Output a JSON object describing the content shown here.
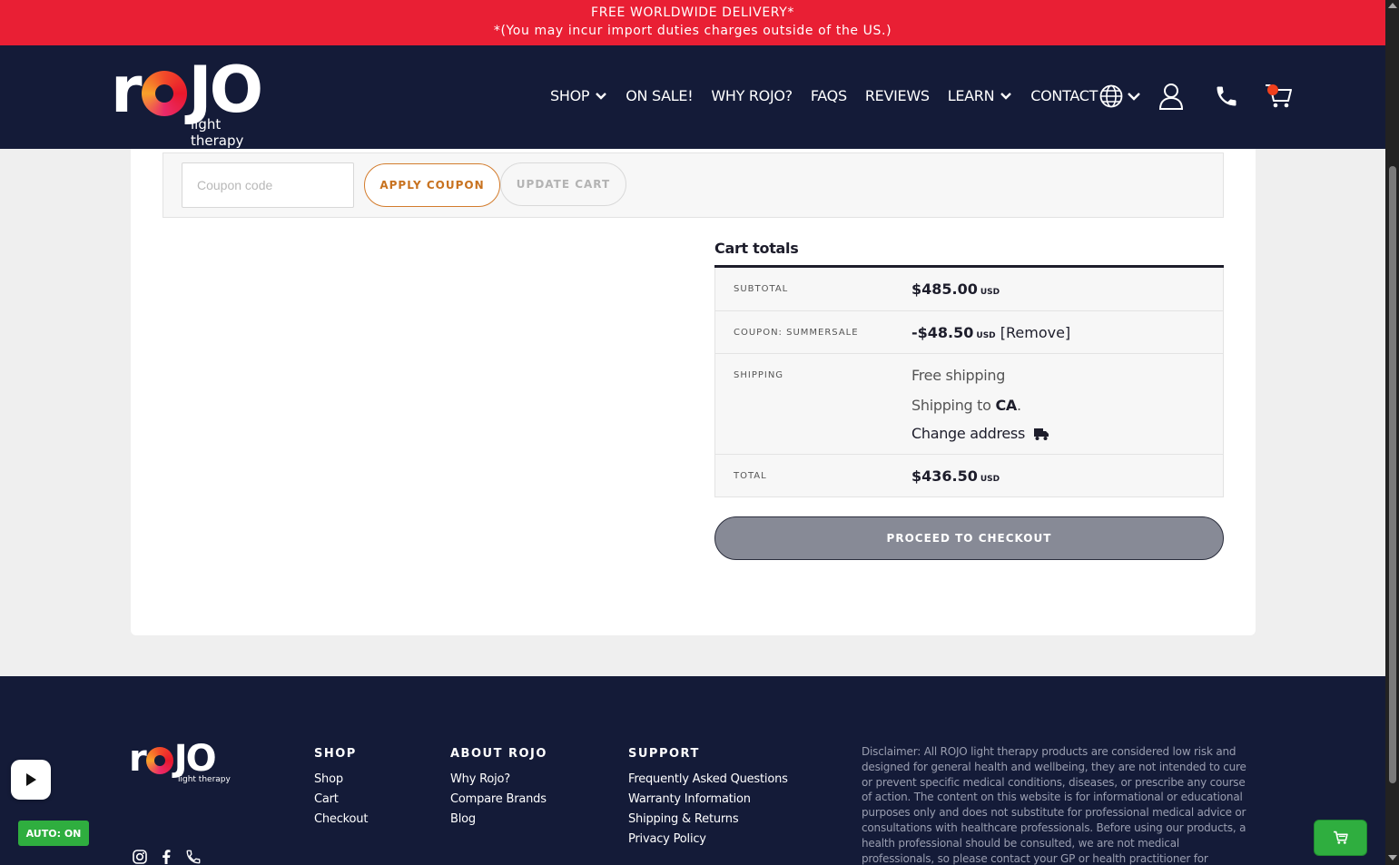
{
  "banner": {
    "line1": "FREE WORLDWIDE DELIVERY*",
    "line2": "*(You may incur import duties charges outside of the US.)"
  },
  "brand": {
    "word_r": "r",
    "word_jo": "JO",
    "tagline": "light therapy"
  },
  "nav": {
    "items": [
      "SHOP",
      "ON SALE!",
      "WHY ROJO?",
      "FAQS",
      "REVIEWS",
      "LEARN",
      "CONTACT"
    ]
  },
  "coupon": {
    "placeholder": "Coupon code",
    "apply_label": "APPLY COUPON",
    "update_label": "UPDATE CART"
  },
  "totals": {
    "title": "Cart totals",
    "subtotal_label": "SUBTOTAL",
    "subtotal_value": "$485.00",
    "coupon_label": "COUPON: SUMMERSALE",
    "coupon_value": "-$48.50",
    "remove_label": "[Remove]",
    "shipping_label": "SHIPPING",
    "shipping_method": "Free shipping",
    "shipping_to_prefix": "Shipping to ",
    "shipping_to_region": "CA",
    "shipping_to_suffix": ".",
    "change_address": "Change address",
    "total_label": "TOTAL",
    "total_value": "$436.50",
    "currency": "USD",
    "checkout_label": "PROCEED TO CHECKOUT"
  },
  "footer": {
    "shop": {
      "title": "SHOP",
      "links": [
        "Shop",
        "Cart",
        "Checkout"
      ]
    },
    "about": {
      "title": "ABOUT ROJO",
      "links": [
        "Why Rojo?",
        "Compare Brands",
        "Blog"
      ]
    },
    "support": {
      "title": "SUPPORT",
      "links": [
        "Frequently Asked Questions",
        "Warranty Information",
        "Shipping & Returns",
        "Privacy Policy"
      ]
    },
    "disclaimer": "Disclaimer: All ROJO light therapy products are considered low risk and designed for general health and wellbeing, they are not intended to cure or prevent specific medical conditions, diseases, or prescribe any course of action. The content on this website is for informational or educational purposes only and does not substitute for professional medical advice or consultations with healthcare professionals. Before using our products, a health professional should be consulted, we are not medical professionals, so please contact your GP or health practitioner for medical advice."
  },
  "widgets": {
    "auto_label": "AUTO: ON"
  },
  "colors": {
    "banner": "#e91f34",
    "navy": "#141b38",
    "accent_orange": "#d37c2d",
    "checkout_grey": "#878a96",
    "green": "#2fae3f"
  },
  "icons": {
    "nav_dropdown": "chevron-down-icon",
    "language": "globe-icon",
    "account": "user-icon",
    "phone": "phone-icon",
    "cart": "cart-icon",
    "shipping": "truck-icon",
    "instagram": "instagram-icon",
    "facebook": "facebook-icon",
    "video": "play-icon"
  }
}
